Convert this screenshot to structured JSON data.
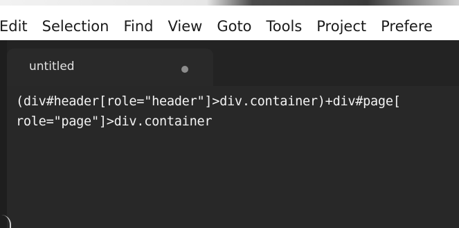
{
  "menubar": {
    "items": [
      "Edit",
      "Selection",
      "Find",
      "View",
      "Goto",
      "Tools",
      "Project",
      "Prefere"
    ]
  },
  "tab": {
    "title": "untitled"
  },
  "editor": {
    "lines": [
      "(div#header[role=\"header\"]>div.container)+div#page[",
      "role=\"page\"]>div.container"
    ]
  },
  "colors": {
    "editor_background": "#282828",
    "tab_background": "#292929",
    "text": "#f2f2f2"
  }
}
